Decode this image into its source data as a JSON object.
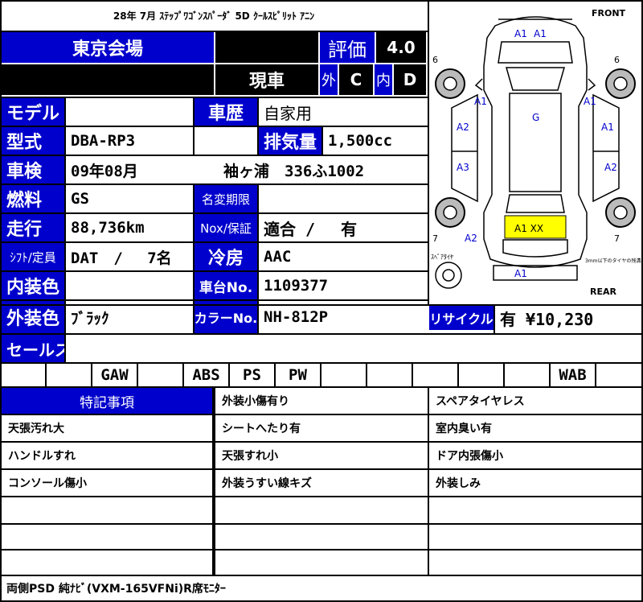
{
  "header": {
    "title": "28年 7月 ｽﾃｯﾌﾟﾜｺﾞﾝｽﾊﾟｰﾀﾞ 5D ｸｰﾙｽﾋﾟﾘｯﾄ ｱﾆﾝ"
  },
  "venue": "東京会場",
  "rating": {
    "label": "評価",
    "score": "4.0"
  },
  "condition": {
    "label": "現車",
    "ext_label": "外",
    "ext_grade": "C",
    "int_label": "内",
    "int_grade": "D"
  },
  "rows": {
    "model_label": "モデル",
    "model_value": "",
    "history_label": "車歴",
    "history_value": "自家用",
    "type_label": "型式",
    "type_value": "DBA-RP3",
    "displacement_label": "排気量",
    "displacement_value": "1,500cc",
    "inspection_label": "車検",
    "inspection_value": "09年08月",
    "plate_value": "袖ヶ浦　336ふ1002",
    "fuel_label": "燃料",
    "fuel_value": "GS",
    "name_change_label": "名変期限",
    "name_change_value": "",
    "mileage_label": "走行",
    "mileage_value": "88,736km",
    "nox_label": "Nox/保証",
    "nox_value": "適合 /　 有",
    "shift_label": "ｼﾌﾄ/定員",
    "shift_value": "DAT　/　 7名",
    "ac_label": "冷房",
    "ac_value": "AAC",
    "interior_label": "内装色",
    "interior_value": "",
    "chassis_label": "車台No.",
    "chassis_value": "1109377",
    "exterior_label": "外装色",
    "exterior_value": "ﾌﾞﾗｯｸ",
    "color_no_label": "カラーNo.",
    "color_no_value": "NH-812P",
    "recycle_label": "リサイクル",
    "recycle_value": "有 ¥10,230",
    "sales_label": "セールス",
    "sales_value": ""
  },
  "equipment": [
    "",
    "",
    "GAW",
    "",
    "ABS",
    "PS",
    "PW",
    "",
    "",
    "",
    "",
    "",
    "WAB",
    ""
  ],
  "features": {
    "title": "特記事項",
    "col1": [
      "",
      "天張汚れ大",
      "ハンドルすれ",
      "コンソール傷小",
      "",
      ""
    ],
    "col2": [
      "外装小傷有り",
      "シートへたり有",
      "天張すれ小",
      "外装うすい線キズ",
      "",
      ""
    ],
    "col3": [
      "スペアタイヤレス",
      "室内臭い有",
      "ドア内張傷小",
      "外装しみ",
      "",
      ""
    ]
  },
  "footer_note": "両側PSD 純ﾅﾋﾞ(VXM-165VFNi)R席ﾓﾆﾀｰ",
  "diagram": {
    "front": "FRONT",
    "rear": "REAR",
    "marks": [
      "A1",
      "A1",
      "A1",
      "A2",
      "A3",
      "G",
      "A1",
      "A1",
      "A2",
      "A2",
      "A1  XX",
      "A1"
    ],
    "tire_labels": [
      "6",
      "6",
      "7",
      "7"
    ],
    "spare_label": "ｽﾍﾟｱﾀｲﾔ",
    "note": "3mm以下のタイヤの残溝表示です",
    "highlight_color": "#ffff00",
    "mark_color": "#0000cc"
  },
  "colors": {
    "blue": "#0000cc",
    "black": "#000000"
  }
}
